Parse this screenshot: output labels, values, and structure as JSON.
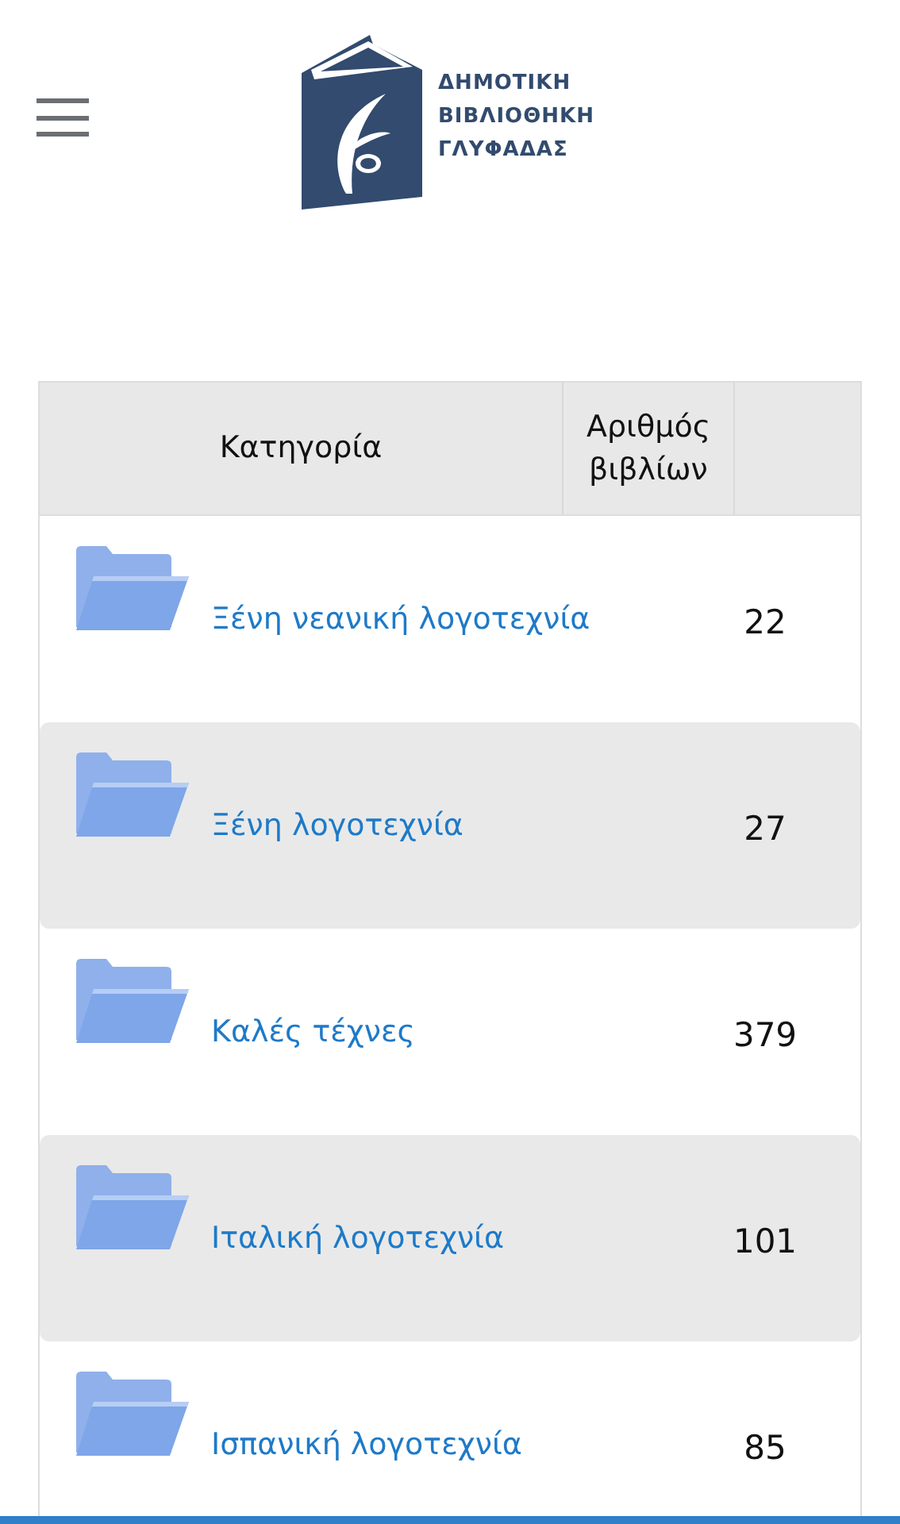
{
  "header": {
    "logo_lines": [
      "ΔΗΜΟΤΙΚΗ",
      "ΒΙΒΛΙΟΘΗΚΗ",
      "ΓΛΥΦΑΔΑΣ"
    ]
  },
  "table": {
    "columns": [
      "Κατηγορία",
      "Αριθμός βιβλίων"
    ],
    "rows": [
      {
        "category": "Ξένη νεανική λογοτεχνία",
        "count": "22"
      },
      {
        "category": "Ξένη λογοτεχνία",
        "count": "27"
      },
      {
        "category": "Καλές τέχνες",
        "count": "379"
      },
      {
        "category": "Ιταλική λογοτεχνία",
        "count": "101"
      },
      {
        "category": "Ισπανική λογοτεχνία",
        "count": "85"
      }
    ]
  }
}
